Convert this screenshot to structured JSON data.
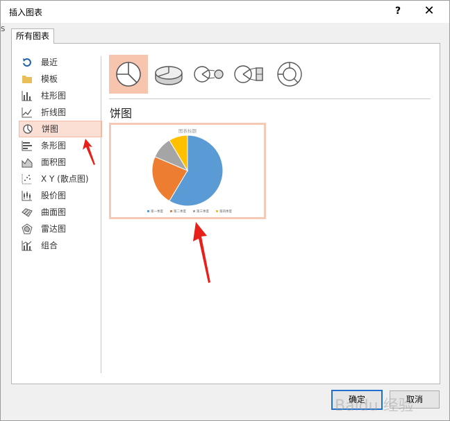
{
  "window": {
    "title": "插入图表",
    "help": "?",
    "close": "✕",
    "edge_text": "S"
  },
  "tab": "所有图表",
  "sidebar": {
    "items": [
      {
        "label": "最近",
        "icon": "recent-arrow-icon"
      },
      {
        "label": "模板",
        "icon": "folder-icon"
      },
      {
        "label": "柱形图",
        "icon": "column-chart-icon"
      },
      {
        "label": "折线图",
        "icon": "line-chart-icon"
      },
      {
        "label": "饼图",
        "icon": "pie-chart-icon",
        "selected": true
      },
      {
        "label": "条形图",
        "icon": "bar-chart-icon"
      },
      {
        "label": "面积图",
        "icon": "area-chart-icon"
      },
      {
        "label": "X Y (散点图)",
        "icon": "scatter-chart-icon"
      },
      {
        "label": "股价图",
        "icon": "stock-chart-icon"
      },
      {
        "label": "曲面图",
        "icon": "surface-chart-icon"
      },
      {
        "label": "雷达图",
        "icon": "radar-chart-icon"
      },
      {
        "label": "组合",
        "icon": "combo-chart-icon"
      }
    ]
  },
  "subtypes": [
    {
      "icon": "pie-icon",
      "selected": true
    },
    {
      "icon": "3d-pie-icon"
    },
    {
      "icon": "pie-of-pie-icon"
    },
    {
      "icon": "bar-of-pie-icon"
    },
    {
      "icon": "doughnut-icon"
    }
  ],
  "chart_heading": "饼图",
  "chart_data": {
    "type": "pie",
    "title": "图表标题",
    "categories": [
      "第一季度",
      "第二季度",
      "第三季度",
      "第四季度"
    ],
    "values": [
      8.2,
      3.2,
      1.4,
      1.2
    ],
    "colors": [
      "#5b9bd5",
      "#ed7d31",
      "#a5a5a5",
      "#ffc000"
    ],
    "legend": "bottom"
  },
  "buttons": {
    "ok": "确定",
    "cancel": "取消"
  },
  "watermark": "Baidu 经验"
}
